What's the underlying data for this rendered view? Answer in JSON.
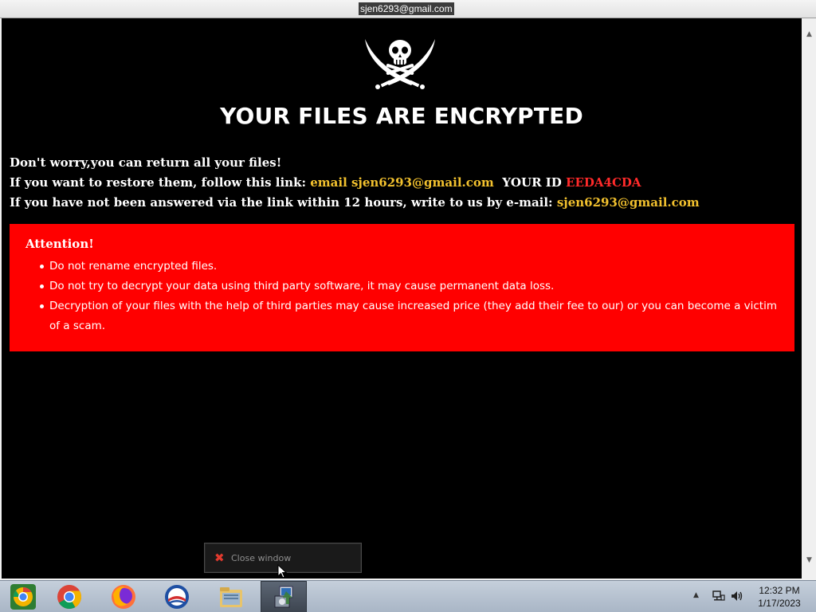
{
  "window": {
    "title": "sjen6293@gmail.com"
  },
  "note": {
    "headline": "YOUR FILES ARE ENCRYPTED",
    "line1": "Don't worry,you can return all your files!",
    "line2_prefix": "If you want to restore them, follow this link:",
    "line2_link": "email sjen6293@gmail.com",
    "line2_id_label": "YOUR ID",
    "line2_id_value": "EEDA4CDA",
    "line3_prefix": "If you have not been answered via the link within 12 hours, write to us by e-mail:",
    "line3_email": "sjen6293@gmail.com",
    "attention_title": "Attention!",
    "attention_items": [
      "Do not rename encrypted files.",
      "Do not try to decrypt your data using third party software, it may cause permanent data loss.",
      "Decryption of your files with the help of third parties may cause increased price (they add their fee to our) or you can become a victim of a scam."
    ]
  },
  "close_button": {
    "label": "Close window"
  },
  "taskbar": {
    "apps": [
      {
        "name": "chrome-canary-icon"
      },
      {
        "name": "chrome-icon"
      },
      {
        "name": "firefox-icon"
      },
      {
        "name": "outlook-icon"
      },
      {
        "name": "file-explorer-icon"
      },
      {
        "name": "installer-icon",
        "active": true
      }
    ],
    "clock_time": "12:32 PM",
    "clock_date": "1/17/2023"
  },
  "colors": {
    "background": "#000000",
    "email_yellow": "#f2c12e",
    "id_red": "#ff2a2a",
    "attention_red": "#ff0000"
  }
}
